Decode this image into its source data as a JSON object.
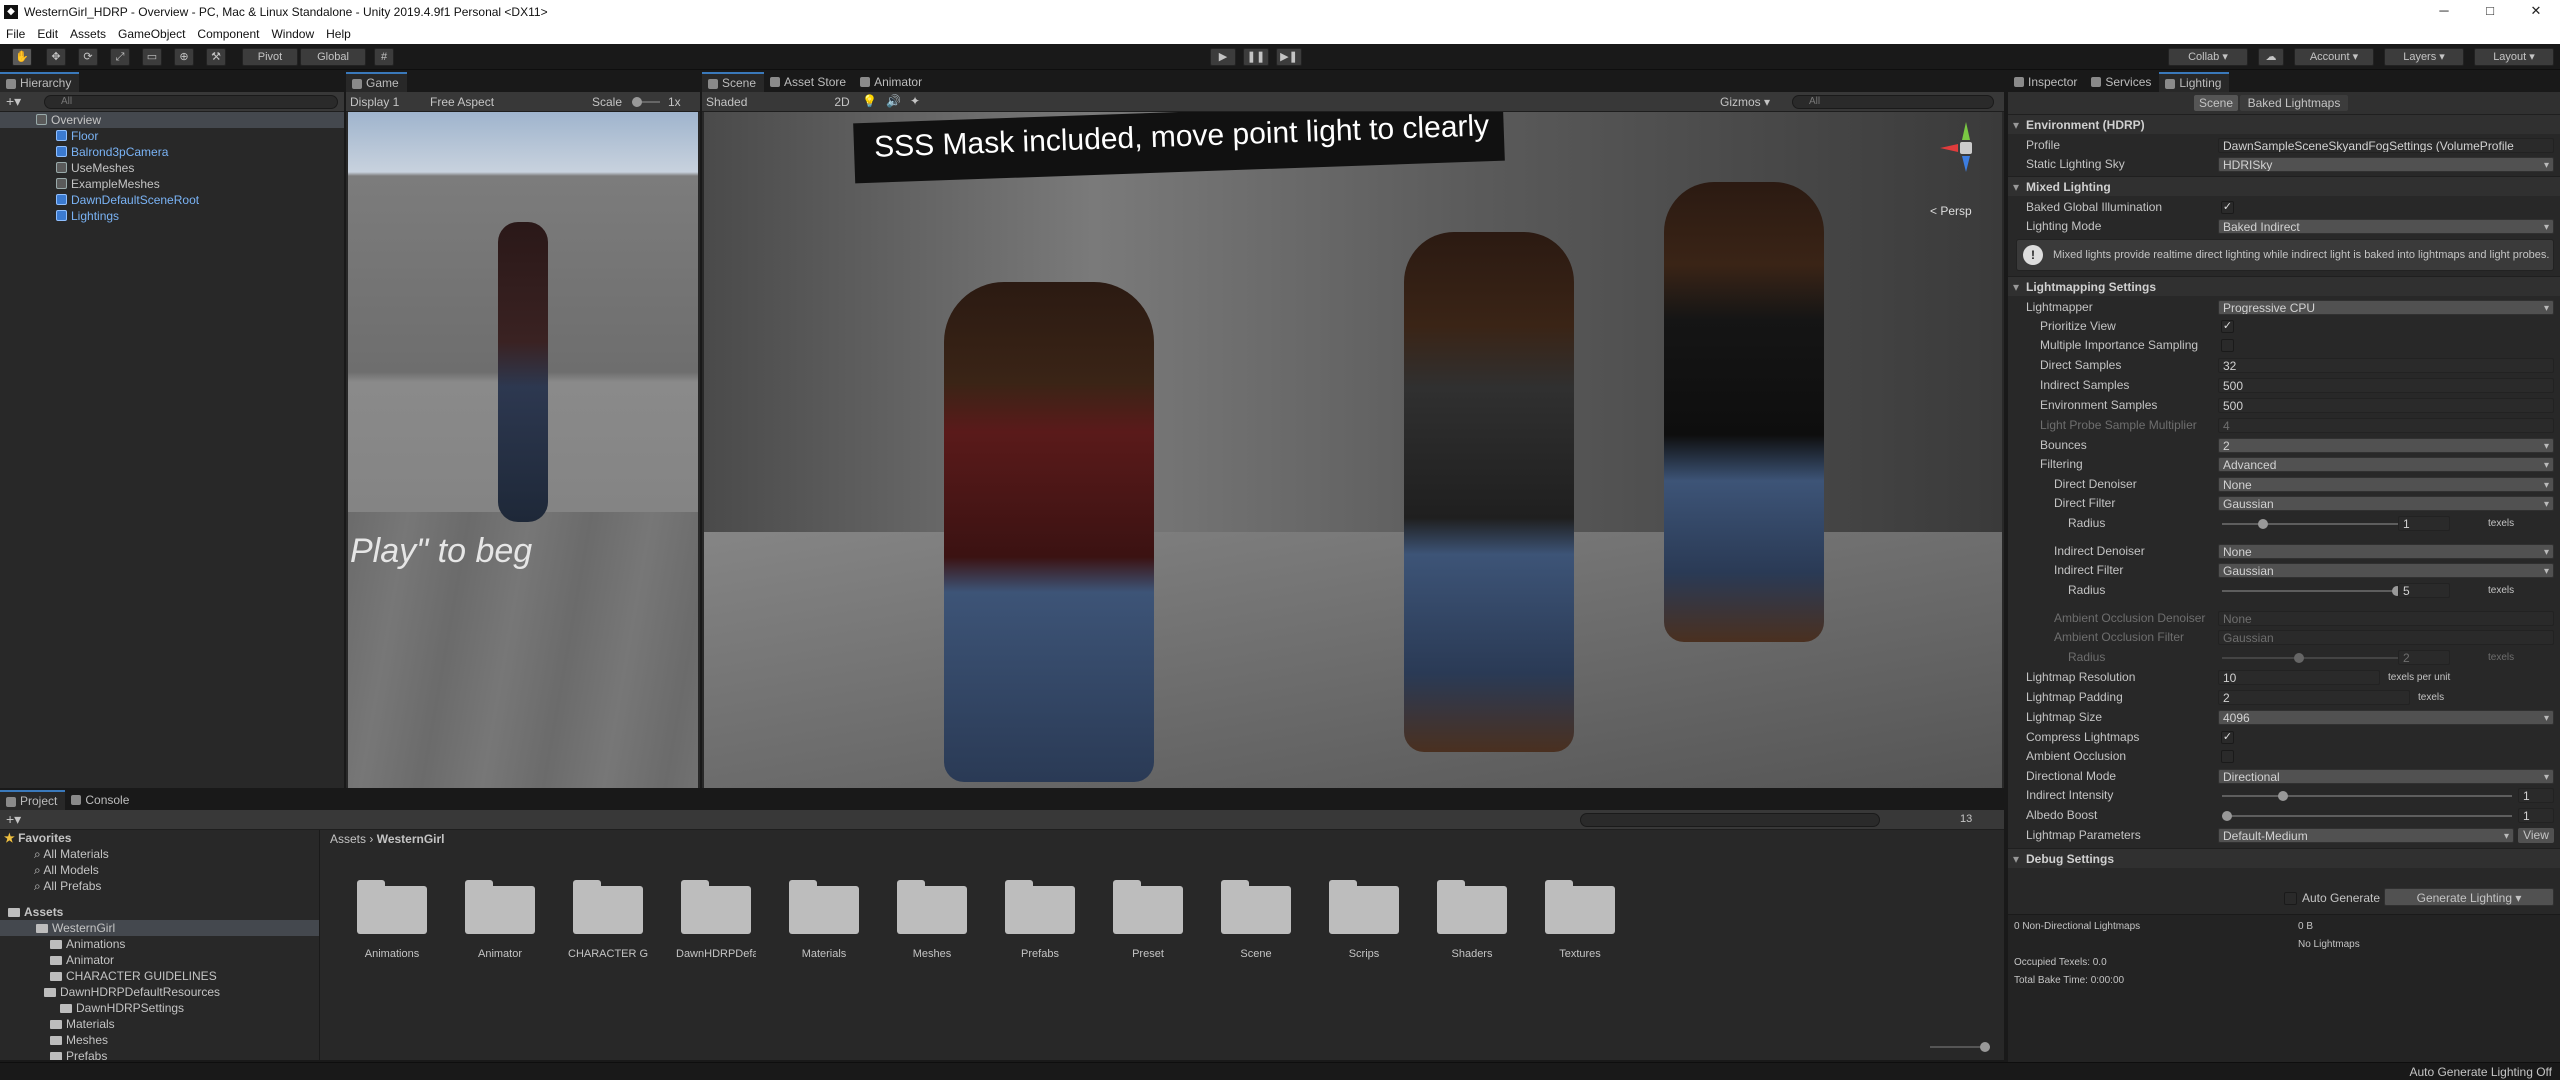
{
  "window": {
    "title": "WesternGirl_HDRP - Overview - PC, Mac & Linux Standalone - Unity 2019.4.9f1 Personal <DX11>",
    "minimize": "─",
    "maximize": "□",
    "close": "✕"
  },
  "menu": [
    "File",
    "Edit",
    "Assets",
    "GameObject",
    "Component",
    "Window",
    "Help"
  ],
  "toolbar": {
    "pivot": "Pivot",
    "global": "Global",
    "play": "▶",
    "pause": "❚❚",
    "step": "▶❚",
    "collab": "Collab ▾",
    "account": "Account ▾",
    "layers": "Layers ▾",
    "layout": "Layout ▾"
  },
  "hierarchy": {
    "tab": "Hierarchy",
    "search": "All",
    "items": [
      {
        "label": "Overview",
        "indent": 0,
        "kind": "scene",
        "selected": true
      },
      {
        "label": "Floor",
        "indent": 1,
        "kind": "blue"
      },
      {
        "label": "Balrond3pCamera",
        "indent": 1,
        "kind": "blue"
      },
      {
        "label": "UseMeshes",
        "indent": 1,
        "kind": "grey"
      },
      {
        "label": "ExampleMeshes",
        "indent": 1,
        "kind": "grey"
      },
      {
        "label": "DawnDefaultSceneRoot",
        "indent": 1,
        "kind": "blue"
      },
      {
        "label": "Lightings",
        "indent": 1,
        "kind": "blue"
      }
    ]
  },
  "game": {
    "tab": "Game",
    "display": "Display 1",
    "aspect": "Free Aspect",
    "scale_label": "Scale",
    "scale_value": "1x",
    "overlay_text": "Play\" to beg"
  },
  "scene": {
    "tabs": [
      "Scene",
      "Asset Store",
      "Animator"
    ],
    "shading": "Shaded",
    "mode2d": "2D",
    "gizmos": "Gizmos ▾",
    "search": "All",
    "banner": "SSS Mask included, move point light to clearly",
    "persp": "< Persp"
  },
  "project": {
    "tabs": [
      "Project",
      "Console"
    ],
    "favorites_label": "Favorites",
    "favorites": [
      "All Materials",
      "All Models",
      "All Prefabs"
    ],
    "assets_label": "Assets",
    "tree": [
      {
        "label": "WesternGirl",
        "indent": 1,
        "selected": true
      },
      {
        "label": "Animations",
        "indent": 2
      },
      {
        "label": "Animator",
        "indent": 2
      },
      {
        "label": "CHARACTER GUIDELINES",
        "indent": 2
      },
      {
        "label": "DawnHDRPDefaultResources",
        "indent": 2
      },
      {
        "label": "DawnHDRPSettings",
        "indent": 3
      },
      {
        "label": "Materials",
        "indent": 2
      },
      {
        "label": "Meshes",
        "indent": 2
      },
      {
        "label": "Prefabs",
        "indent": 2
      }
    ],
    "breadcrumb": [
      "Assets",
      "WesternGirl"
    ],
    "folders": [
      "Animations",
      "Animator",
      "CHARACTER GUI...",
      "DawnHDRPDefaul...",
      "Materials",
      "Meshes",
      "Prefabs",
      "Preset",
      "Scene",
      "Scrips",
      "Shaders",
      "Textures"
    ],
    "count": "13"
  },
  "inspector": {
    "tabs": [
      "Inspector",
      "Services",
      "Lighting"
    ],
    "subtabs": [
      "Scene",
      "Baked Lightmaps"
    ],
    "env_header": "Environment (HDRP)",
    "profile_label": "Profile",
    "profile_value": "DawnSampleSceneSkyandFogSettings (VolumeProfile",
    "sky_label": "Static Lighting Sky",
    "sky_value": "HDRISky",
    "mixed_header": "Mixed Lighting",
    "bgi_label": "Baked Global Illumination",
    "mode_label": "Lighting Mode",
    "mode_value": "Baked Indirect",
    "info": "Mixed lights provide realtime direct lighting while indirect light is baked into lightmaps and light probes.",
    "lm_header": "Lightmapping Settings",
    "lightmapper_label": "Lightmapper",
    "lightmapper_value": "Progressive CPU",
    "prio_label": "Prioritize View",
    "mis_label": "Multiple Importance Sampling",
    "ds_label": "Direct Samples",
    "ds_value": "32",
    "is_label": "Indirect Samples",
    "is_value": "500",
    "es_label": "Environment Samples",
    "es_value": "500",
    "lp_label": "Light Probe Sample Multiplier",
    "lp_value": "4",
    "bounces_label": "Bounces",
    "bounces_value": "2",
    "filtering_label": "Filtering",
    "filtering_value": "Advanced",
    "dd_label": "Direct Denoiser",
    "dd_value": "None",
    "df_label": "Direct Filter",
    "df_value": "Gaussian",
    "radius_label": "Radius",
    "radius1": "1",
    "texels": "texels",
    "id_label": "Indirect Denoiser",
    "id_value": "None",
    "if_label": "Indirect Filter",
    "if_value": "Gaussian",
    "radius2": "5",
    "aod_label": "Ambient Occlusion Denoiser",
    "aod_value": "None",
    "aof_label": "Ambient Occlusion Filter",
    "aof_value": "Gaussian",
    "radius3": "2",
    "res_label": "Lightmap Resolution",
    "res_value": "10",
    "res_unit": "texels per unit",
    "pad_label": "Lightmap Padding",
    "pad_value": "2",
    "size_label": "Lightmap Size",
    "size_value": "4096",
    "compress_label": "Compress Lightmaps",
    "ao_label": "Ambient Occlusion",
    "dir_label": "Directional Mode",
    "dir_value": "Directional",
    "ii_label": "Indirect Intensity",
    "ii_value": "1",
    "ab_label": "Albedo Boost",
    "ab_value": "1",
    "params_label": "Lightmap Parameters",
    "params_value": "Default-Medium",
    "view_btn": "View",
    "debug_header": "Debug Settings",
    "auto_label": "Auto Generate",
    "generate_btn": "Generate Lighting ▾",
    "stats_l1": "0 Non-Directional Lightmaps",
    "stats_v1": "0 B",
    "stats_v2": "No Lightmaps",
    "stats_l2": "Occupied Texels: 0.0",
    "stats_l3": "Total Bake Time: 0:00:00"
  },
  "statusbar": "Auto Generate Lighting Off"
}
